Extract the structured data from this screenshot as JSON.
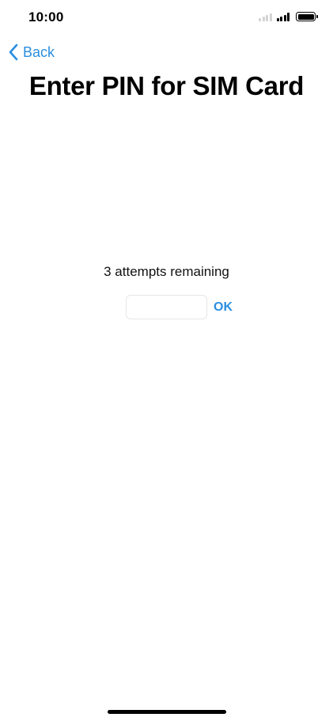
{
  "status_bar": {
    "time": "10:00",
    "icons": [
      "signal-dim-icon",
      "signal-icon",
      "battery-icon"
    ]
  },
  "nav": {
    "back_label": "Back",
    "back_icon": "chevron-left-icon"
  },
  "title": "Enter PIN for SIM Card",
  "pin": {
    "attempts_text": "3 attempts remaining",
    "value": "",
    "placeholder": "",
    "ok_label": "OK"
  },
  "colors": {
    "accent": "#2a8ee0",
    "background": "#ffffff",
    "text": "#000000"
  }
}
